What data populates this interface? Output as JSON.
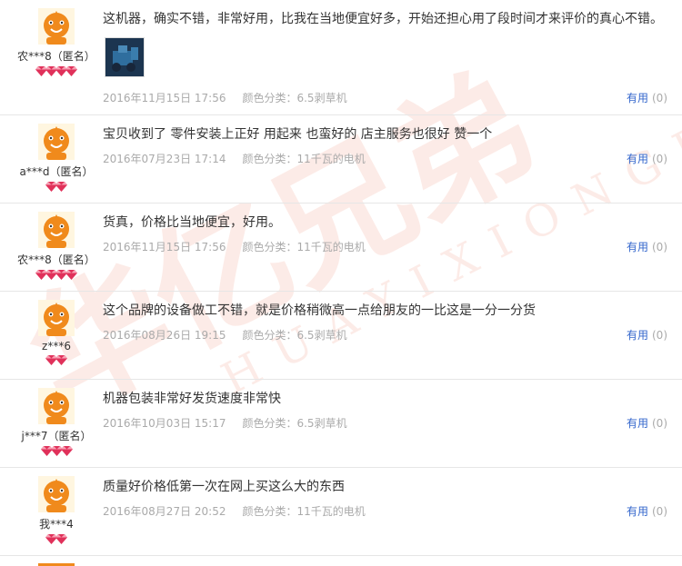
{
  "watermark": {
    "brand": "华亿兄弟",
    "latin": "HUAYIXIONGDI",
    "color": "#f28a70"
  },
  "colors": {
    "link": "#3366cc",
    "meta": "#aaaaaa",
    "text": "#333333",
    "diamond": "#e0315a",
    "avatar": "#f08a1c"
  },
  "reviews": [
    {
      "user": "农***8（匿名）",
      "rank": 4,
      "content": "这机器，确实不错，非常好用，比我在当地便宜好多，开始还担心用了段时间才来评价的真心不错。",
      "has_photo": true,
      "date": "2016年11月15日 17:56",
      "category": "颜色分类：6.5剥草机",
      "useful_label": "有用",
      "useful_count": "(0)"
    },
    {
      "user": "a***d（匿名）",
      "rank": 2,
      "content": "宝贝收到了 零件安装上正好 用起来 也蛮好的 店主服务也很好 赞一个",
      "has_photo": false,
      "date": "2016年07月23日 17:14",
      "category": "颜色分类：11千瓦的电机",
      "useful_label": "有用",
      "useful_count": "(0)"
    },
    {
      "user": "农***8（匿名）",
      "rank": 4,
      "content": "货真，价格比当地便宜，好用。",
      "has_photo": false,
      "date": "2016年11月15日 17:56",
      "category": "颜色分类：11千瓦的电机",
      "useful_label": "有用",
      "useful_count": "(0)"
    },
    {
      "user": "z***6",
      "rank": 2,
      "content": "这个品牌的设备做工不错，就是价格稍微高一点给朋友的一比这是一分一分货",
      "has_photo": false,
      "date": "2016年08月26日 19:15",
      "category": "颜色分类：6.5剥草机",
      "useful_label": "有用",
      "useful_count": "(0)"
    },
    {
      "user": "j***7（匿名）",
      "rank": 3,
      "content": "机器包装非常好发货速度非常快",
      "has_photo": false,
      "date": "2016年10月03日 15:17",
      "category": "颜色分类：6.5剥草机",
      "useful_label": "有用",
      "useful_count": "(0)"
    },
    {
      "user": "我***4",
      "rank": 2,
      "content": "质量好价格低第一次在网上买这么大的东西",
      "has_photo": false,
      "date": "2016年08月27日 20:52",
      "category": "颜色分类：11千瓦的电机",
      "useful_label": "有用",
      "useful_count": "(0)"
    }
  ]
}
